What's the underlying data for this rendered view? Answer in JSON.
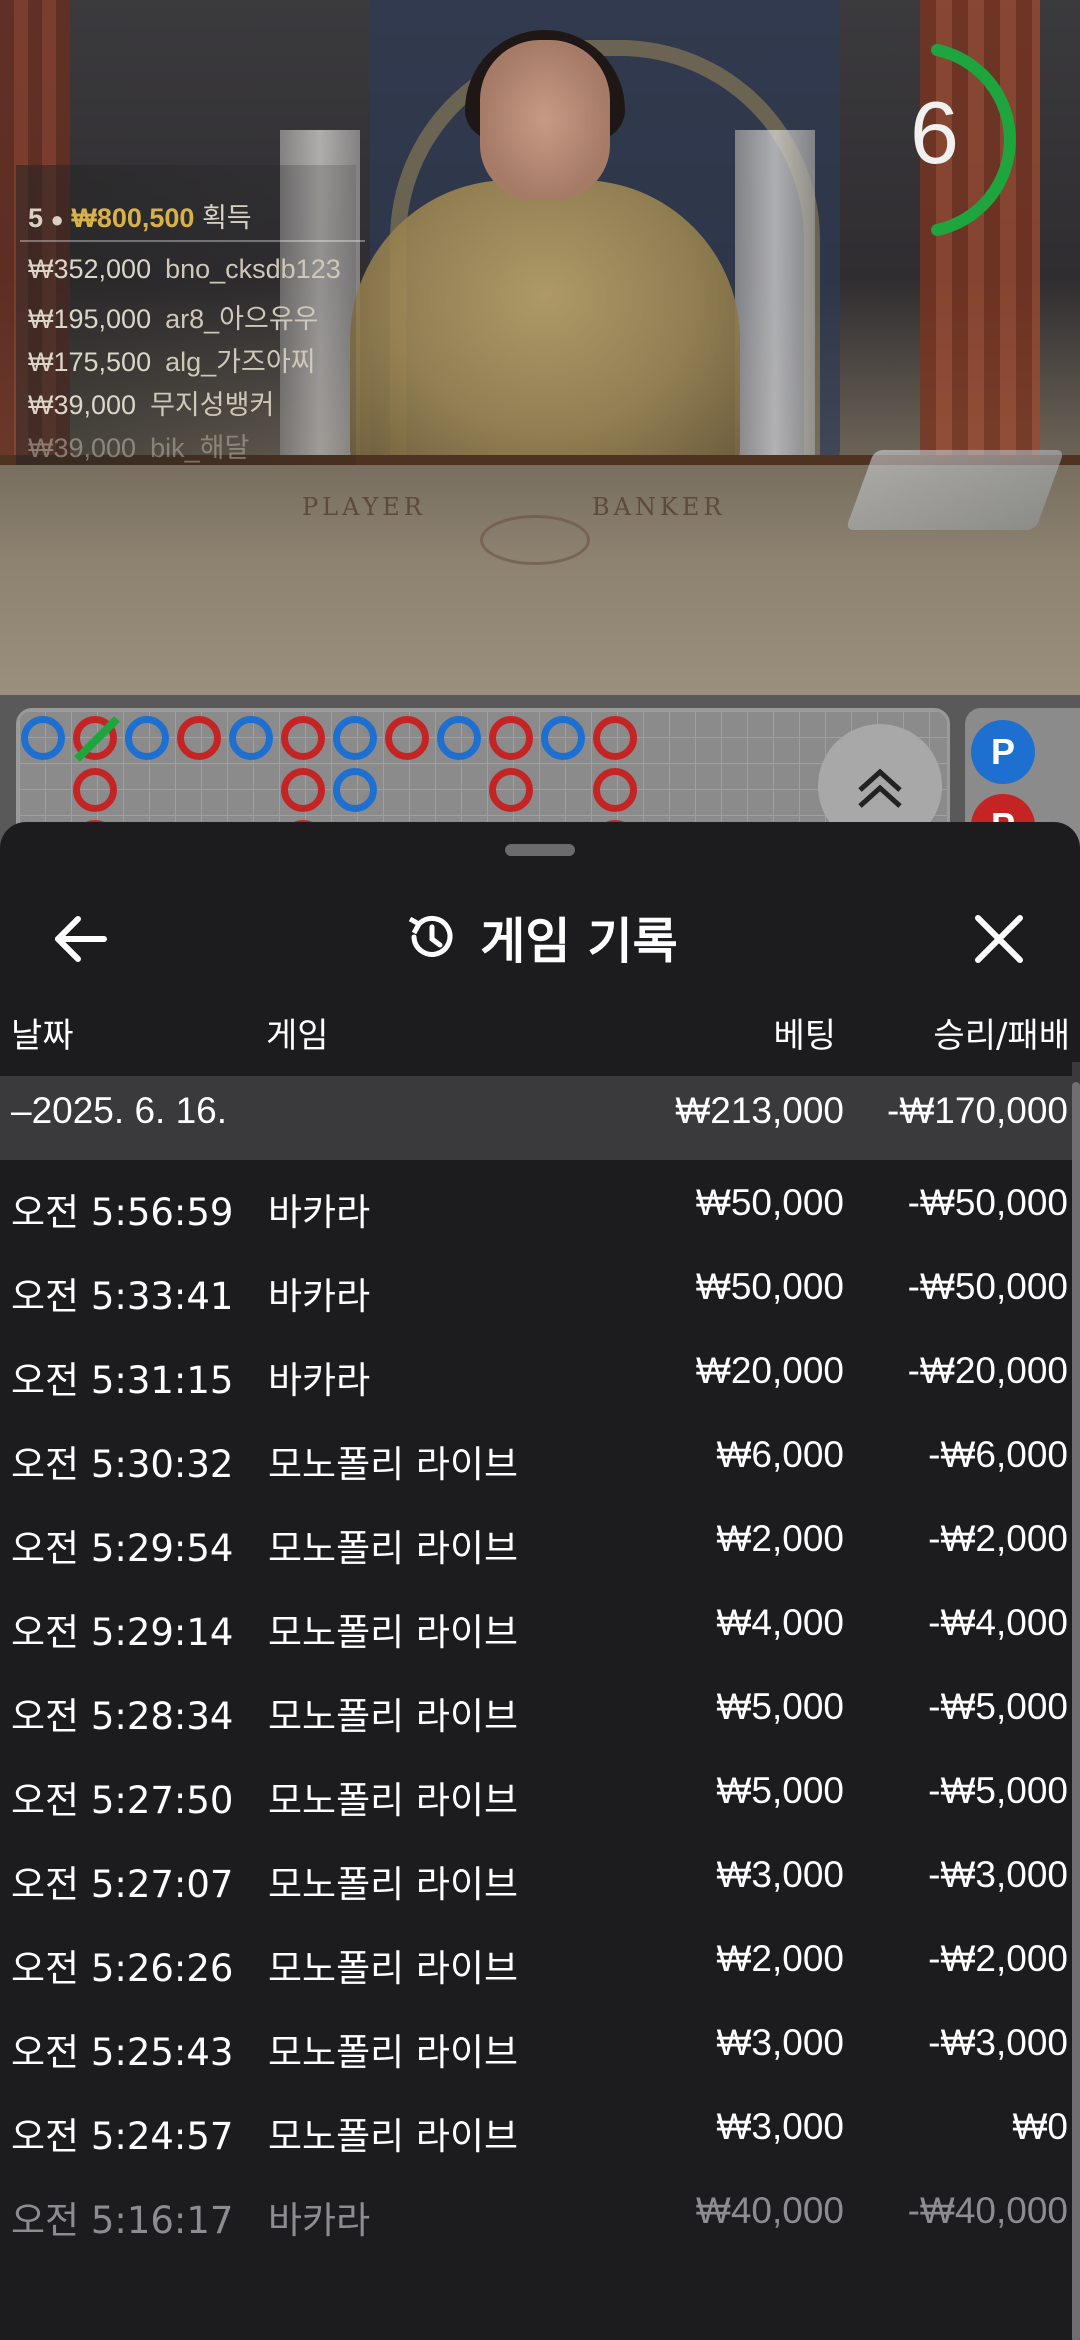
{
  "video": {
    "table_left_label": "PLAYER",
    "table_right_label": "BANKER",
    "timer_value": "6",
    "timer_color": "#1fa53d"
  },
  "winners": {
    "count": "5",
    "total": "₩800,500",
    "total_label": "획득",
    "list": [
      {
        "amount": "₩352,000",
        "user": "bno_cksdb123"
      },
      {
        "amount": "₩195,000",
        "user": "ar8_아으유우"
      },
      {
        "amount": "₩175,500",
        "user": "alg_가즈아찌"
      },
      {
        "amount": "₩39,000",
        "user": "무지성뱅커"
      },
      {
        "amount": "₩39,000",
        "user": "bik_해달"
      }
    ]
  },
  "road": {
    "player_color": "#1d6fd0",
    "banker_color": "#c52424",
    "side_labels": [
      "P",
      "P"
    ]
  },
  "sheet": {
    "title": "게임 기록",
    "icons": {
      "back": "arrow-left-icon",
      "history": "history-icon",
      "close": "close-icon",
      "expand": "chevrons-up-icon"
    },
    "columns": {
      "date": "날짜",
      "game": "게임",
      "bet": "베팅",
      "win_loss": "승리/패배"
    },
    "date_group": {
      "date": "–2025. 6. 16.",
      "bet": "₩213,000",
      "win_loss": "-₩170,000"
    },
    "rows": [
      {
        "time": "오전 5:56:59",
        "game": "바카라",
        "bet": "₩50,000",
        "win_loss": "-₩50,000"
      },
      {
        "time": "오전 5:33:41",
        "game": "바카라",
        "bet": "₩50,000",
        "win_loss": "-₩50,000"
      },
      {
        "time": "오전 5:31:15",
        "game": "바카라",
        "bet": "₩20,000",
        "win_loss": "-₩20,000"
      },
      {
        "time": "오전 5:30:32",
        "game": "모노폴리 라이브",
        "bet": "₩6,000",
        "win_loss": "-₩6,000"
      },
      {
        "time": "오전 5:29:54",
        "game": "모노폴리 라이브",
        "bet": "₩2,000",
        "win_loss": "-₩2,000"
      },
      {
        "time": "오전 5:29:14",
        "game": "모노폴리 라이브",
        "bet": "₩4,000",
        "win_loss": "-₩4,000"
      },
      {
        "time": "오전 5:28:34",
        "game": "모노폴리 라이브",
        "bet": "₩5,000",
        "win_loss": "-₩5,000"
      },
      {
        "time": "오전 5:27:50",
        "game": "모노폴리 라이브",
        "bet": "₩5,000",
        "win_loss": "-₩5,000"
      },
      {
        "time": "오전 5:27:07",
        "game": "모노폴리 라이브",
        "bet": "₩3,000",
        "win_loss": "-₩3,000"
      },
      {
        "time": "오전 5:26:26",
        "game": "모노폴리 라이브",
        "bet": "₩2,000",
        "win_loss": "-₩2,000"
      },
      {
        "time": "오전 5:25:43",
        "game": "모노폴리 라이브",
        "bet": "₩3,000",
        "win_loss": "-₩3,000"
      },
      {
        "time": "오전 5:24:57",
        "game": "모노폴리 라이브",
        "bet": "₩3,000",
        "win_loss": "₩0"
      },
      {
        "time": "오전 5:16:17",
        "game": "바카라",
        "bet": "₩40,000",
        "win_loss": "-₩40,000"
      }
    ]
  }
}
